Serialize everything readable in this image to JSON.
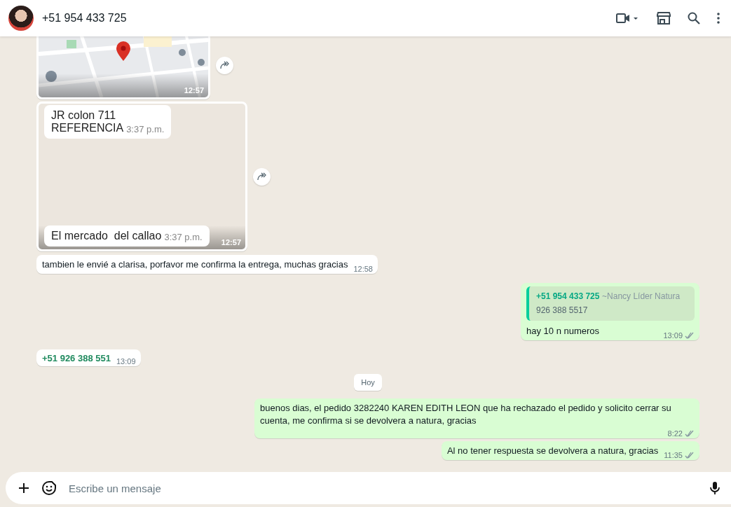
{
  "header": {
    "contact_name": "+51 954 433 725"
  },
  "messages": [
    {
      "kind": "map",
      "outgoing": false,
      "time": "12:57",
      "forwardable": true
    },
    {
      "kind": "screenshot",
      "outgoing": false,
      "time": "12:57",
      "forwardable": true,
      "inner_messages": [
        {
          "text": "JR colon 711\nREFERENCIA",
          "time": "3:37 p.m."
        },
        {
          "text": "El mercado  del callao",
          "time": "3:37 p.m."
        }
      ]
    },
    {
      "kind": "text",
      "outgoing": false,
      "text": "tambien le envié a clarisa, porfavor me confirma la entrega, muchas gracias",
      "time": "12:58"
    },
    {
      "kind": "quote",
      "outgoing": true,
      "quote_author": "+51 954 433 725",
      "quote_name": "~Nancy Líder Natura",
      "quote_text": "926 388 5517",
      "text": "hay 10 n numeros",
      "time": "13:09",
      "delivered": true
    },
    {
      "kind": "contact",
      "outgoing": false,
      "text": "+51 926 388 551",
      "time": "13:09"
    },
    {
      "kind": "date",
      "text": "Hoy"
    },
    {
      "kind": "text",
      "outgoing": true,
      "text": "buenos dias, el pedido 3282240 KAREN EDITH LEON que ha rechazado el pedido y solicito cerrar su cuenta, me confirma si se devolvera a natura, gracias",
      "time": "8:22",
      "delivered": true
    },
    {
      "kind": "text",
      "outgoing": true,
      "text": "Al no tener respuesta se devolvera a natura, gracias",
      "time": "11:35",
      "delivered": true
    }
  ],
  "composer": {
    "placeholder": "Escribe un mensaje"
  }
}
